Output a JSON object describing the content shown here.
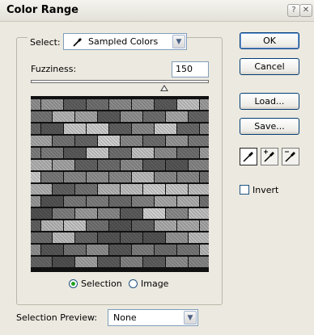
{
  "window": {
    "title": "Color Range"
  },
  "select": {
    "label": "Select:",
    "value": "Sampled Colors",
    "icon": "eyedropper-icon"
  },
  "fuzziness": {
    "label": "Fuzziness:",
    "value": "150",
    "level_fraction": 0.75
  },
  "view": {
    "selection_label": "Selection",
    "image_label": "Image",
    "selected": "selection"
  },
  "buttons": {
    "ok": "OK",
    "cancel": "Cancel",
    "load": "Load...",
    "save": "Save..."
  },
  "tools": [
    "eyedropper-icon",
    "eyedropper-plus-icon",
    "eyedropper-minus-icon"
  ],
  "invert": {
    "label": "Invert",
    "checked": false
  },
  "selection_preview": {
    "label": "Selection Preview:",
    "value": "None"
  }
}
